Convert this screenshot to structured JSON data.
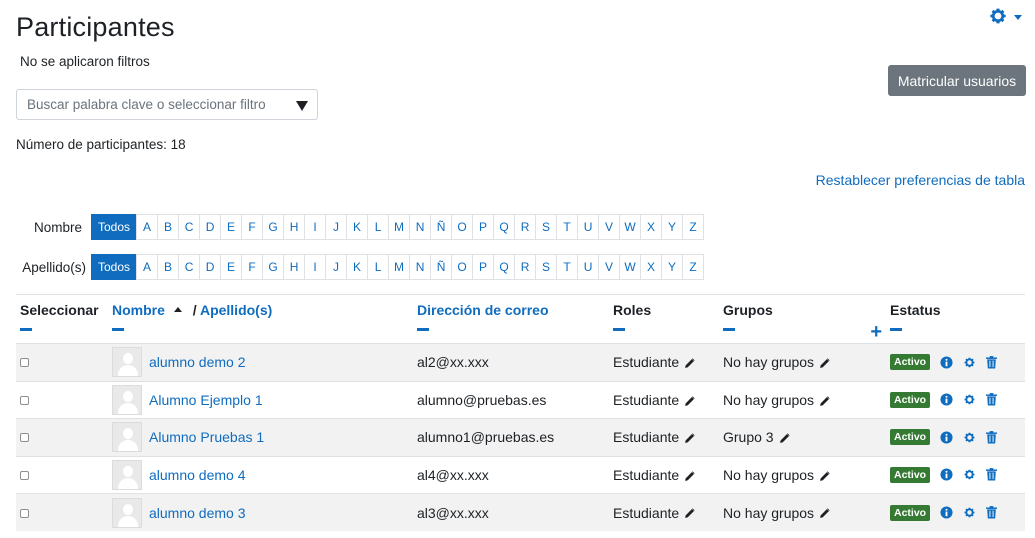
{
  "page": {
    "title": "Participantes",
    "filters_status": "No se aplicaron filtros",
    "enrol_button": "Matricular usuarios",
    "search_placeholder": "Buscar palabra clave o seleccionar filtro",
    "participant_count": "Número de participantes: 18",
    "reset_prefs": "Restablecer preferencias de tabla"
  },
  "initials": {
    "first_label": "Nombre",
    "last_label": "Apellido(s)",
    "all_label": "Todos",
    "letters": [
      "A",
      "B",
      "C",
      "D",
      "E",
      "F",
      "G",
      "H",
      "I",
      "J",
      "K",
      "L",
      "M",
      "N",
      "Ñ",
      "O",
      "P",
      "Q",
      "R",
      "S",
      "T",
      "U",
      "V",
      "W",
      "X",
      "Y",
      "Z"
    ]
  },
  "table": {
    "headers": {
      "select": "Seleccionar",
      "firstname": "Nombre",
      "separator": "/",
      "lastname": "Apellido(s)",
      "email": "Dirección de correo",
      "roles": "Roles",
      "groups": "Grupos",
      "status": "Estatus"
    },
    "rows": [
      {
        "name": "alumno demo 2",
        "email": "al2@xx.xxx",
        "role": "Estudiante",
        "groups": "No hay grupos",
        "status": "Activo"
      },
      {
        "name": "Alumno Ejemplo 1",
        "email": "alumno@pruebas.es",
        "role": "Estudiante",
        "groups": "No hay grupos",
        "status": "Activo"
      },
      {
        "name": "Alumno Pruebas 1",
        "email": "alumno1@pruebas.es",
        "role": "Estudiante",
        "groups": "Grupo 3",
        "status": "Activo"
      },
      {
        "name": "alumno demo 4",
        "email": "al4@xx.xxx",
        "role": "Estudiante",
        "groups": "No hay grupos",
        "status": "Activo"
      },
      {
        "name": "alumno demo 3",
        "email": "al3@xx.xxx",
        "role": "Estudiante",
        "groups": "No hay grupos",
        "status": "Activo"
      }
    ]
  },
  "colors": {
    "link": "#0f6cbf",
    "button_secondary": "#6c757d",
    "badge_active": "#357a32",
    "row_stripe": "#f2f2f2"
  },
  "icons": {
    "page_menu": "gear-icon",
    "row_info": "info-icon",
    "row_edit": "gear-icon",
    "row_delete": "trash-icon",
    "inline_edit": "pencil-icon",
    "sort": "sort-asc-icon"
  }
}
